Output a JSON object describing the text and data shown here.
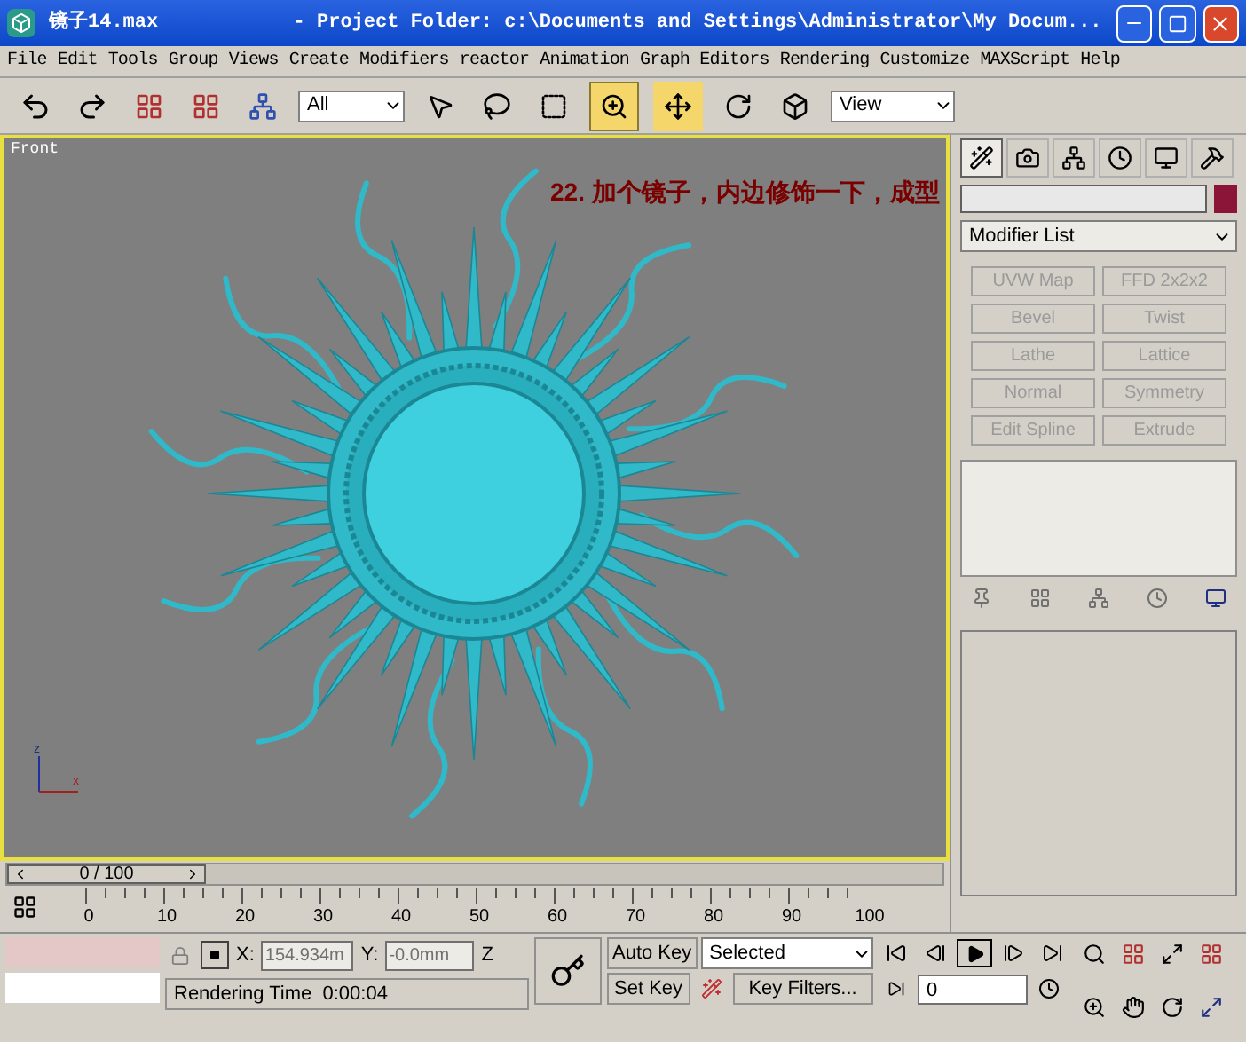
{
  "title_bar": {
    "file": "镜子14.max",
    "project": "- Project Folder: c:\\Documents and Settings\\Administrator\\My Docum..."
  },
  "menu": [
    "File",
    "Edit",
    "Tools",
    "Group",
    "Views",
    "Create",
    "Modifiers",
    "reactor",
    "Animation",
    "Graph Editors",
    "Rendering",
    "Customize",
    "MAXScript",
    "Help"
  ],
  "toolbar": {
    "selection_filter": "All",
    "reference_coord": "View"
  },
  "viewport": {
    "label": "Front",
    "annotation": "22. 加个镜子，内边修饰一下，成型",
    "active": true,
    "axis_labels": [
      "z",
      "x"
    ]
  },
  "command_panel": {
    "tabs": [
      {
        "selected": true
      },
      {
        "selected": false
      },
      {
        "selected": false
      },
      {
        "selected": false
      },
      {
        "selected": false
      },
      {
        "selected": false
      }
    ],
    "modifier_list": "Modifier List",
    "modifier_buttons": [
      {
        "label": "UVW Map",
        "disabled": true
      },
      {
        "label": "FFD 2x2x2",
        "disabled": true
      },
      {
        "label": "Bevel",
        "disabled": true
      },
      {
        "label": "Twist",
        "disabled": true
      },
      {
        "label": "Lathe",
        "disabled": true
      },
      {
        "label": "Lattice",
        "disabled": true
      },
      {
        "label": "Normal",
        "disabled": true
      },
      {
        "label": "Symmetry",
        "disabled": true
      },
      {
        "label": "Edit Spline",
        "disabled": true
      },
      {
        "label": "Extrude",
        "disabled": true
      }
    ]
  },
  "time_slider": {
    "reading": "0 / 100",
    "level": 0
  },
  "track_bar": {
    "labels": [
      "0",
      "10",
      "20",
      "30",
      "40",
      "50",
      "60",
      "70",
      "80",
      "90",
      "100"
    ]
  },
  "status": {
    "x_label": "X:",
    "x": "154.934m",
    "y_label": "Y:",
    "y": "-0.0mm",
    "z_label": "Z",
    "prompt": "Rendering Time  0:00:04"
  },
  "animation": {
    "auto_key": "Auto Key",
    "key_mode": "Selected",
    "set_key": "Set Key",
    "key_filters": "Key Filters...",
    "frame": "0"
  }
}
